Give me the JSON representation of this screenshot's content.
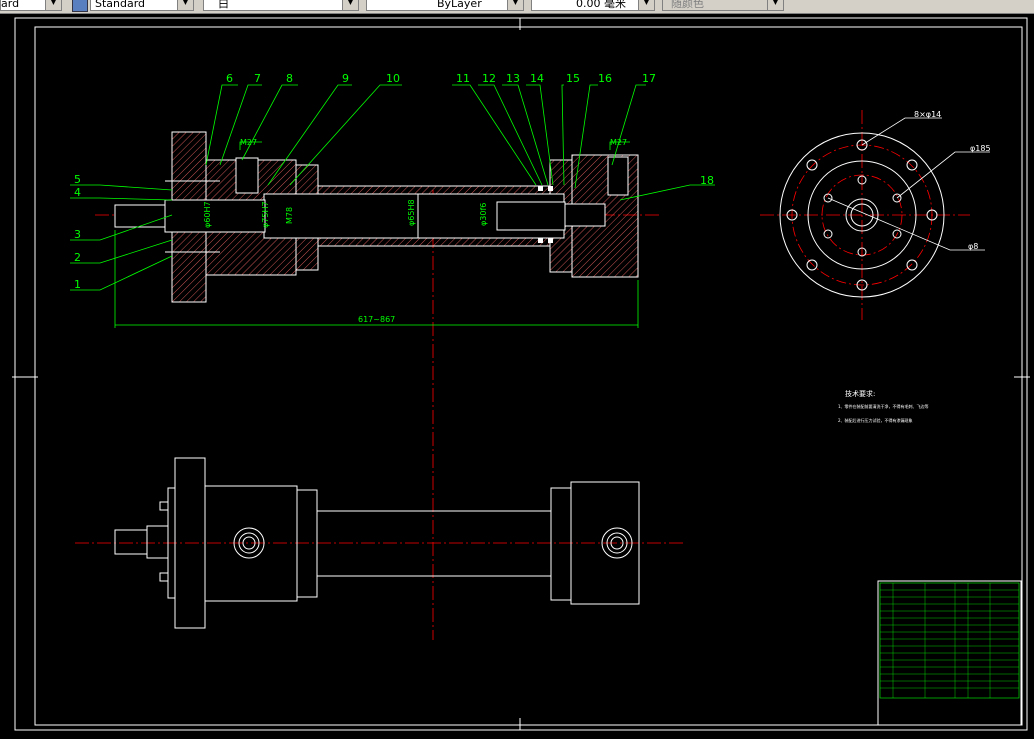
{
  "toolbar": {
    "textstyle_partial": "ard",
    "dimstyle": "Standard",
    "layer": "白",
    "linetype": "ByLayer",
    "lineweight": "0.00 毫米",
    "plotstyle": "随颜色"
  },
  "balloons": [
    "1",
    "2",
    "3",
    "4",
    "5",
    "6",
    "7",
    "8",
    "9",
    "10",
    "11",
    "12",
    "13",
    "14",
    "15",
    "16",
    "17",
    "18"
  ],
  "dims": {
    "thread_left": "M27",
    "thread_right": "M27",
    "overall_length": "617~867",
    "d1": "φ60H7",
    "d2": "φ75H7",
    "d3": "M78",
    "d4": "φ65H8",
    "d5": "φ30f6"
  },
  "end_view": {
    "holes_label": "8×φ14",
    "pcd_label": "φ185",
    "small_label": "φ8"
  },
  "notes": {
    "title": "技术要求:",
    "line1": "1、零件在装配前要清洗干净，不得有毛刺、飞边等",
    "line2": "2、装配后进行压力试验，不得有渗漏现象"
  },
  "colors": {
    "background": "#000000",
    "geometry": "#ffffff",
    "dimension": "#00ff00",
    "centerline": "#ff0000",
    "hatch": "#ff6b6b",
    "outline": "#ffffff"
  }
}
